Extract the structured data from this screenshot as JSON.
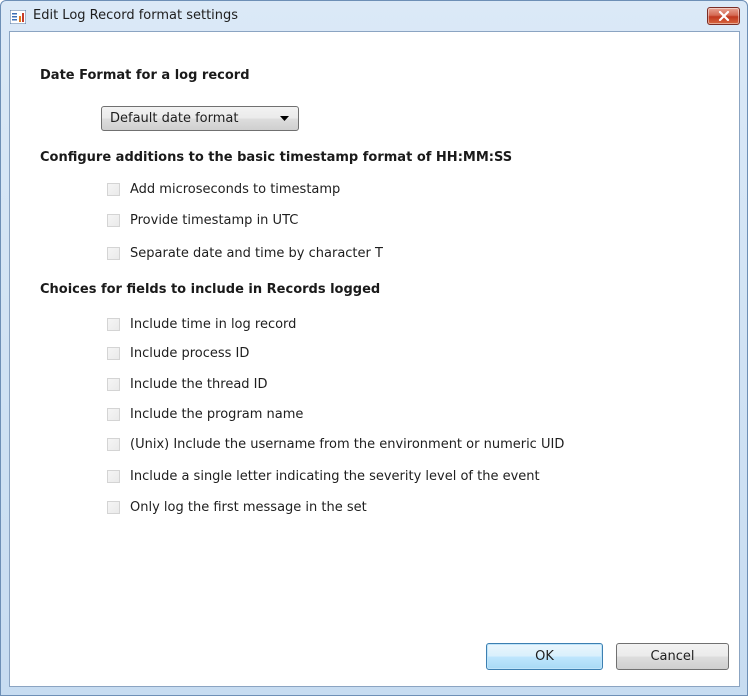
{
  "window": {
    "title": "Edit Log Record format settings"
  },
  "date_format": {
    "heading": "Date Format for a log record",
    "selected": "Default date format"
  },
  "timestamp": {
    "heading": "Configure additions to the basic timestamp format of HH:MM:SS",
    "options": [
      {
        "label": "Add microseconds to timestamp",
        "checked": false
      },
      {
        "label": "Provide timestamp in UTC",
        "checked": false
      },
      {
        "label": "Separate date and time by character T",
        "checked": false
      }
    ]
  },
  "fields": {
    "heading": "Choices for fields to include in Records logged",
    "options": [
      {
        "label": "Include time in log record",
        "checked": false
      },
      {
        "label": "Include process ID",
        "checked": false
      },
      {
        "label": "Include the thread ID",
        "checked": false
      },
      {
        "label": "Include the program name",
        "checked": false
      },
      {
        "label": "(Unix) Include the username from the environment or numeric UID",
        "checked": false
      },
      {
        "label": "Include a single letter indicating the severity level of the event",
        "checked": false
      },
      {
        "label": "Only log the first message in the set",
        "checked": false
      }
    ]
  },
  "buttons": {
    "ok": "OK",
    "cancel": "Cancel"
  },
  "colors": {
    "frame": "#c7dcf1",
    "close_button": "#c1381f",
    "default_button_border": "#3c7fb1"
  },
  "icons": {
    "window": "window-settings-icon",
    "close": "close-icon",
    "dropdown": "chevron-down-icon"
  }
}
